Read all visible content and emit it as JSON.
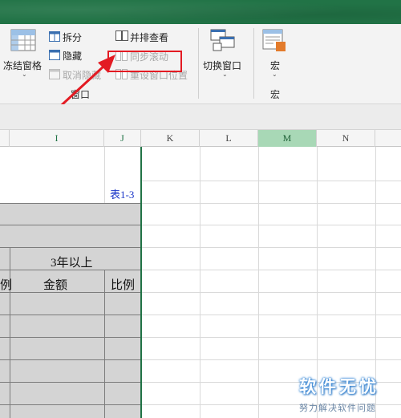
{
  "ribbon": {
    "freeze_panes_label": "冻结窗格",
    "split_label": "拆分",
    "hide_label": "隐藏",
    "unhide_label": "取消隐藏",
    "side_by_side_label": "并排查看",
    "sync_scroll_label": "同步滚动",
    "reset_position_label": "重设窗口位置",
    "switch_windows_label": "切换窗口",
    "macros_label": "宏",
    "group_window_label": "窗口",
    "group_macros_label": "宏"
  },
  "columns": [
    "I",
    "J",
    "K",
    "L",
    "M",
    "N"
  ],
  "sheet": {
    "table_ref": "表1-3",
    "header_3yrs": "3年以上",
    "partial_ratio": "例",
    "amount": "金额",
    "ratio": "比例"
  },
  "watermark": {
    "title": "软件无忧",
    "subtitle": "努力解决软件问题"
  },
  "colors": {
    "excel_green": "#217346",
    "highlight_red": "#e31b23",
    "selected_column": "#a8d8b6"
  }
}
